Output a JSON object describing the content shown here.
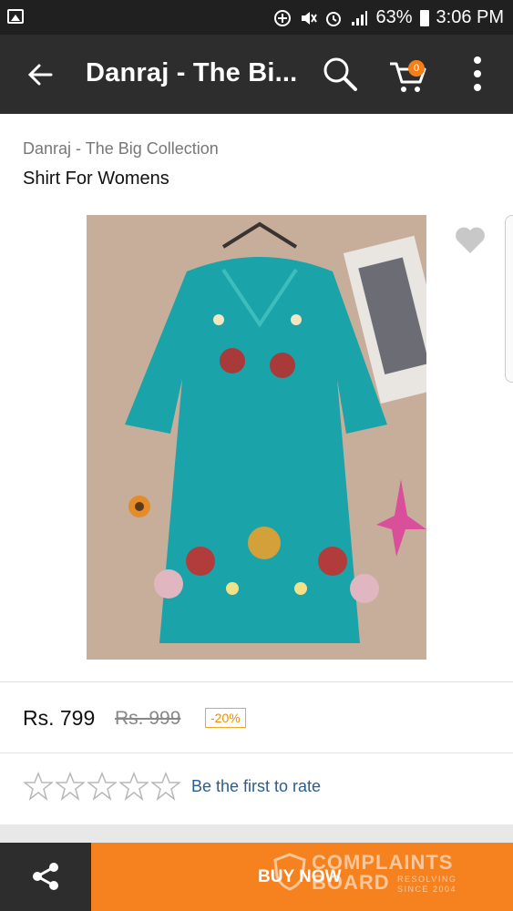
{
  "status_bar": {
    "battery": "63%",
    "time": "3:06 PM"
  },
  "app_bar": {
    "title": "Danraj - The Bi...",
    "cart_count": "0"
  },
  "product": {
    "brand": "Danraj - The Big Collection",
    "name": "Shirt For Womens",
    "price": "Rs. 799",
    "original_price": "Rs. 999",
    "discount": "-20%"
  },
  "rating": {
    "stars": 0,
    "max_stars": 5,
    "cta": "Be the first to rate"
  },
  "bottom_bar": {
    "buy_label": "BUY NOW"
  },
  "watermark": {
    "line1": "COMPLAINTS",
    "line2": "BOARD",
    "tag1": "RESOLVING",
    "tag2": "SINCE 2004"
  },
  "colors": {
    "app_bar": "#2d2d2d",
    "status_bar": "#202020",
    "accent": "#f5821f",
    "link": "#2a5d8f"
  }
}
